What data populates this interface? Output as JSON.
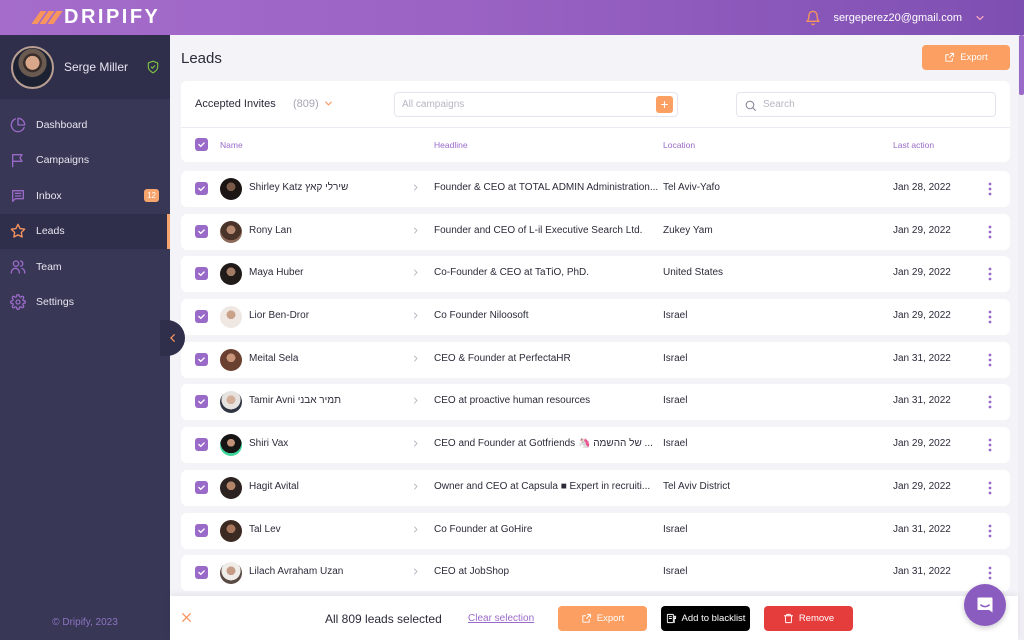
{
  "brand": {
    "name": "DRIPIFY",
    "accent": "#9a6ac8",
    "orange": "#fb9f62"
  },
  "topbar": {
    "email": "sergeperez20@gmail.com"
  },
  "sidebar": {
    "user_name": "Serge Miller",
    "items": [
      {
        "label": "Dashboard",
        "icon": "pie-chart-icon"
      },
      {
        "label": "Campaigns",
        "icon": "flag-icon"
      },
      {
        "label": "Inbox",
        "icon": "message-icon",
        "badge": "12"
      },
      {
        "label": "Leads",
        "icon": "star-icon",
        "active": true
      },
      {
        "label": "Team",
        "icon": "users-icon"
      },
      {
        "label": "Settings",
        "icon": "gear-icon"
      }
    ],
    "copyright": "© Dripify, 2023"
  },
  "main": {
    "title": "Leads",
    "export_label": "Export",
    "filter": {
      "list_label": "Accepted Invites",
      "list_count": "(809)",
      "campaigns_placeholder": "All campaigns",
      "search_placeholder": "Search"
    },
    "columns": {
      "name": "Name",
      "headline": "Headline",
      "location": "Location",
      "last_action": "Last action"
    },
    "leads": [
      {
        "name": "Shirley Katz שירלי קאץ",
        "headline": "Founder & CEO at TOTAL ADMIN Administration...",
        "location": "Tel Aviv-Yafo",
        "last_action": "Jan 28, 2022",
        "checked": true
      },
      {
        "name": "Rony Lan",
        "headline": "Founder and CEO of L-il Executive Search Ltd.",
        "location": "Zukey Yam",
        "last_action": "Jan 29, 2022",
        "checked": true
      },
      {
        "name": "Maya Huber",
        "headline": "Co-Founder & CEO at TaTiO, PhD.",
        "location": "United States",
        "last_action": "Jan 29, 2022",
        "checked": true
      },
      {
        "name": "Lior Ben-Dror",
        "headline": "Co Founder Niloosoft",
        "location": "Israel",
        "last_action": "Jan 29, 2022",
        "checked": true
      },
      {
        "name": "Meital Sela",
        "headline": "CEO & Founder at PerfectaHR",
        "location": "Israel",
        "last_action": "Jan 31, 2022",
        "checked": true
      },
      {
        "name": "Tamir Avni תמיר אבני",
        "headline": "CEO at proactive human resources",
        "location": "Israel",
        "last_action": "Jan 31, 2022",
        "checked": true
      },
      {
        "name": "Shiri Vax",
        "headline": "CEO and Founder at Gotfriends 🦄 של ההשמה ...",
        "location": "Israel",
        "last_action": "Jan 29, 2022",
        "checked": true
      },
      {
        "name": "Hagit Avital",
        "headline": "Owner and CEO at Capsula ■ Expert in recruiti...",
        "location": "Tel Aviv District",
        "last_action": "Jan 29, 2022",
        "checked": true
      },
      {
        "name": "Tal Lev",
        "headline": "Co Founder at GoHire",
        "location": "Israel",
        "last_action": "Jan 31, 2022",
        "checked": true
      },
      {
        "name": "Lilach Avraham Uzan",
        "headline": "CEO at JobShop",
        "location": "Israel",
        "last_action": "Jan 31, 2022",
        "checked": true
      }
    ]
  },
  "bottom_bar": {
    "selection_text": "All 809 leads selected",
    "clear_label": "Clear selection",
    "export_label": "Export",
    "blacklist_label": "Add to blacklist",
    "remove_label": "Remove"
  }
}
